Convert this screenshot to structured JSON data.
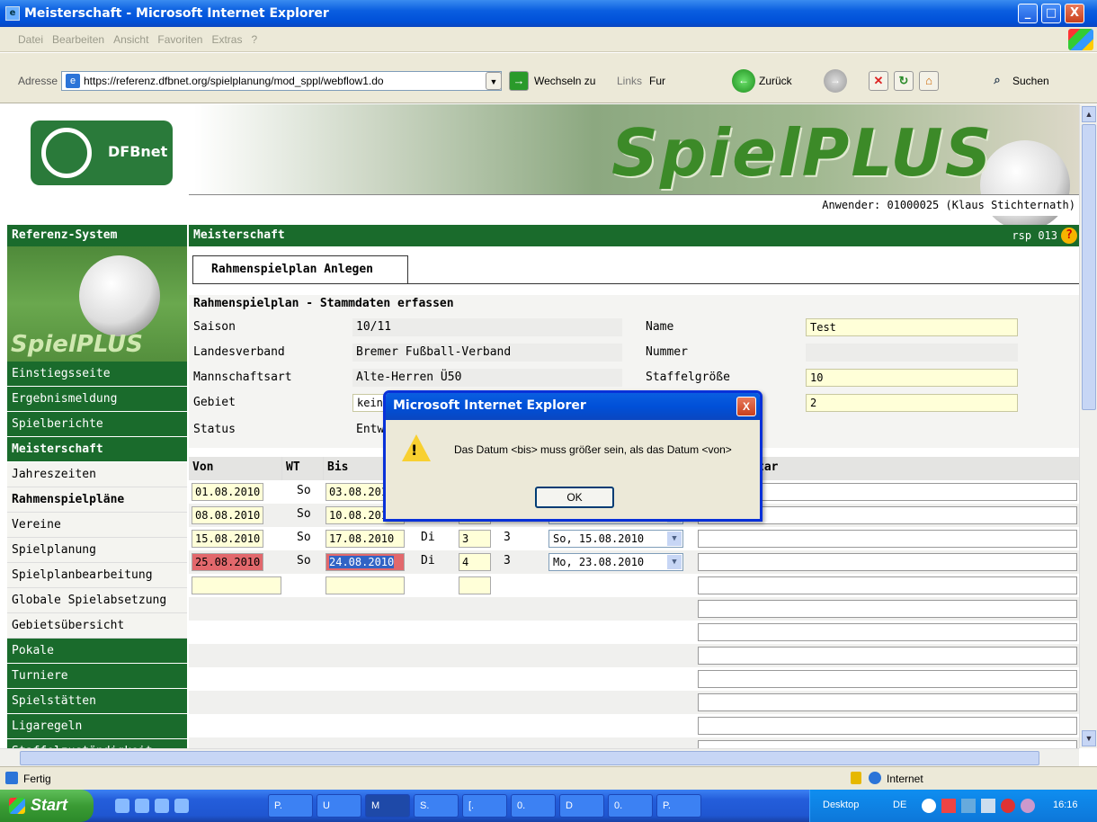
{
  "window": {
    "title": "Meisterschaft - Microsoft Internet Explorer",
    "min": "_",
    "max": "□",
    "close": "X"
  },
  "menu": [
    "Datei",
    "Bearbeiten",
    "Ansicht",
    "Favoriten",
    "Extras",
    "?"
  ],
  "address": {
    "label": "Adresse",
    "url": "https://referenz.dfbnet.org/spielplanung/mod_sppl/webflow1.do",
    "go": "Wechseln zu",
    "links": "Links",
    "fur": "Fur",
    "back": "Zurück",
    "search": "Suchen"
  },
  "banner": {
    "logo": "DFBnet",
    "brand": "SpielPLUS",
    "user": "Anwender: 01000025 (Klaus Stichternath)"
  },
  "sidebar": {
    "head": "Referenz-System",
    "brand": "SpielPLUS",
    "items": [
      {
        "label": "Einstiegsseite",
        "style": "g"
      },
      {
        "label": "Ergebnismeldung",
        "style": "g"
      },
      {
        "label": "Spielberichte",
        "style": "g"
      },
      {
        "label": "Meisterschaft",
        "style": "gb"
      },
      {
        "label": "Jahreszeiten",
        "style": "w"
      },
      {
        "label": "Rahmenspielpläne",
        "style": "wb"
      },
      {
        "label": "Vereine",
        "style": "w"
      },
      {
        "label": "Spielplanung",
        "style": "w"
      },
      {
        "label": "Spielplanbearbeitung",
        "style": "w"
      },
      {
        "label": "Globale Spielabsetzung",
        "style": "w"
      },
      {
        "label": "Gebietsübersicht",
        "style": "w"
      },
      {
        "label": "Pokale",
        "style": "g"
      },
      {
        "label": "Turniere",
        "style": "g"
      },
      {
        "label": "Spielstätten",
        "style": "g"
      },
      {
        "label": "Ligaregeln",
        "style": "g"
      },
      {
        "label": "Staffelzuständigkeit",
        "style": "g"
      }
    ]
  },
  "main": {
    "head": "Meisterschaft",
    "code": "rsp 013",
    "help": "?",
    "tab": "Rahmenspielplan Anlegen",
    "section": "Rahmenspielplan - Stammdaten erfassen"
  },
  "form": {
    "saison_label": "Saison",
    "saison": "10/11",
    "lv_label": "Landesverband",
    "lv": "Bremer Fußball-Verband",
    "ma_label": "Mannschaftsart",
    "ma": "Alte-Herren Ü50",
    "gebiet_label": "Gebiet",
    "gebiet": "kein",
    "status_label": "Status",
    "status": "Entw",
    "name_label": "Name",
    "name": "Test",
    "nummer_label": "Nummer",
    "nummer": "",
    "sg_label": "Staffelgröße",
    "sg": "10",
    "x_value": "2"
  },
  "grid": {
    "headers": {
      "von": "Von",
      "wt": "WT",
      "bis": "Bis",
      "bem": "tar"
    },
    "rows": [
      {
        "von": "01.08.2010",
        "wt": "So",
        "bis": "03.08.201",
        "wt2": "",
        "n": "",
        "n2": "",
        "sel": ""
      },
      {
        "von": "08.08.2010",
        "wt": "So",
        "bis": "10.08.201",
        "wt2": "",
        "n": "",
        "n2": "",
        "sel": ""
      },
      {
        "von": "15.08.2010",
        "wt": "So",
        "bis": "17.08.2010",
        "wt2": "Di",
        "n": "3",
        "n2": "3",
        "sel": "So, 15.08.2010"
      },
      {
        "von": "25.08.2010",
        "wt": "So",
        "bis": "24.08.2010",
        "wt2": "Di",
        "n": "4",
        "n2": "3",
        "sel": "Mo, 23.08.2010"
      }
    ]
  },
  "dialog": {
    "title": "Microsoft Internet Explorer",
    "message": "Das Datum <bis> muss größer sein, als das Datum <von>",
    "ok": "OK",
    "close": "X"
  },
  "status": {
    "text": "Fertig",
    "zone": "Internet"
  },
  "taskbar": {
    "start": "Start",
    "tasks": [
      "P.",
      "U",
      "M",
      "S.",
      "[.",
      "0.",
      "D",
      "0.",
      "P."
    ],
    "desktop": "Desktop",
    "lang": "DE",
    "clock": "16:16"
  }
}
